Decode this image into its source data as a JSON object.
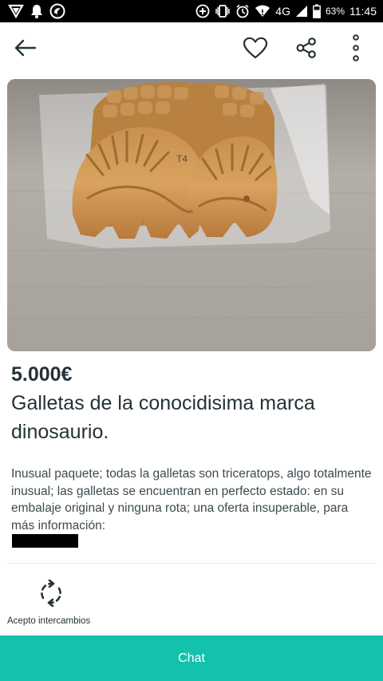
{
  "status_bar": {
    "network": "4G",
    "battery": "63%",
    "time": "11:45"
  },
  "app_bar": {
    "icons": [
      "back-arrow-icon",
      "heart-icon",
      "share-icon",
      "more-vertical-icon"
    ]
  },
  "product": {
    "image_text": "T4",
    "price": "5.000€",
    "title": "Galletas de la conocidisima marca dinosaurio.",
    "description": "Inusual paquete; todas la galletas  son triceratops, algo totalmente inusual; las galletas se encuentran  en perfecto estado: en su embalaje original y ninguna rota; una oferta insuperable, para más información:",
    "exchange_label": "Acepto intercambios"
  },
  "chat": {
    "label": "Chat"
  },
  "colors": {
    "accent": "#13c1ac",
    "text": "#253238"
  }
}
